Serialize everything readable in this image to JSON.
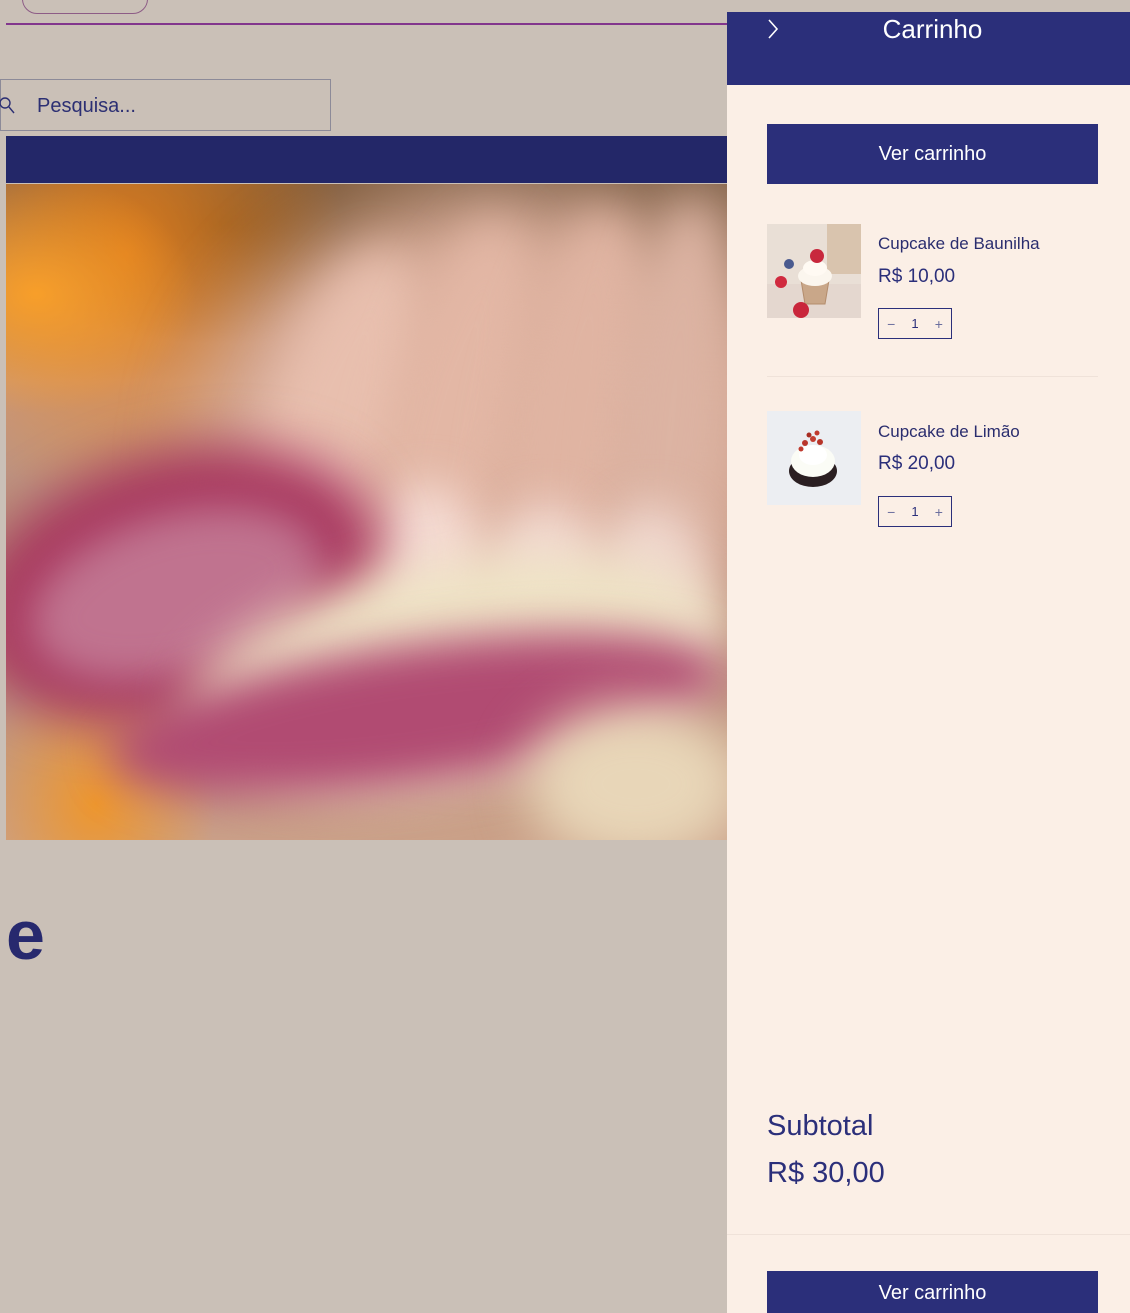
{
  "search": {
    "placeholder": "Pesquisa..."
  },
  "hero": {
    "heading_fragment": "e"
  },
  "cart": {
    "title": "Carrinho",
    "view_cart_top": "Ver carrinho",
    "view_cart_bottom": "Ver carrinho",
    "items": [
      {
        "name": "Cupcake de Baunilha",
        "price": "R$ 10,00",
        "quantity": "1"
      },
      {
        "name": "Cupcake de Limão",
        "price": "R$ 20,00",
        "quantity": "1"
      }
    ],
    "subtotal_label": "Subtotal",
    "subtotal_value": "R$ 30,00",
    "decrement_symbol": "−",
    "increment_symbol": "+"
  },
  "colors": {
    "page_background": "#cac0b7",
    "nav_dark": "#232768",
    "accent_purple": "#82368d",
    "cart_background": "#fbefe6",
    "cart_primary": "#2b2f7a"
  },
  "icons": {
    "close": "chevron-right-icon",
    "search": "search-icon"
  }
}
